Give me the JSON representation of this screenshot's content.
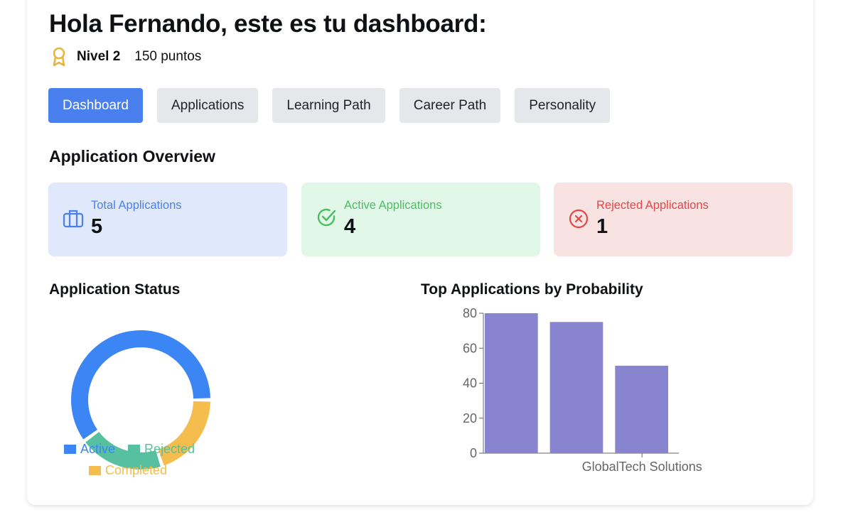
{
  "header": {
    "title": "Hola Fernando, este es tu dashboard:",
    "level": "Nivel 2",
    "points": "150 puntos",
    "level_icon": "award-icon"
  },
  "tabs": [
    {
      "label": "Dashboard",
      "active": true
    },
    {
      "label": "Applications"
    },
    {
      "label": "Learning Path"
    },
    {
      "label": "Career Path"
    },
    {
      "label": "Personality"
    }
  ],
  "overview": {
    "title": "Application Overview",
    "cards": [
      {
        "label": "Total Applications",
        "value": "5",
        "icon": "briefcase-icon",
        "color": "#4a80ee",
        "bg": "#dfe9fb"
      },
      {
        "label": "Active Applications",
        "value": "4",
        "icon": "check-circle-icon",
        "color": "#4cbd62",
        "bg": "#e1f8e8"
      },
      {
        "label": "Rejected Applications",
        "value": "1",
        "icon": "x-circle-icon",
        "color": "#e04848",
        "bg": "#f8e2e2"
      }
    ]
  },
  "chart_data": [
    {
      "type": "pie",
      "title": "Application Status",
      "donut": true,
      "categories": [
        "Active",
        "Rejected",
        "Completed"
      ],
      "values": [
        3,
        1,
        1
      ],
      "colors": [
        "#3b86f4",
        "#57c19f",
        "#f4bd4d"
      ],
      "legend": "bottom"
    },
    {
      "type": "bar",
      "title": "Top Applications by Probability",
      "categories": [
        "",
        "",
        "GlobalTech Solutions"
      ],
      "values": [
        80,
        75,
        50
      ],
      "ylim": [
        0,
        80
      ],
      "yticks": [
        0,
        20,
        40,
        60,
        80
      ],
      "color": "#8884d0",
      "grid": false
    }
  ]
}
